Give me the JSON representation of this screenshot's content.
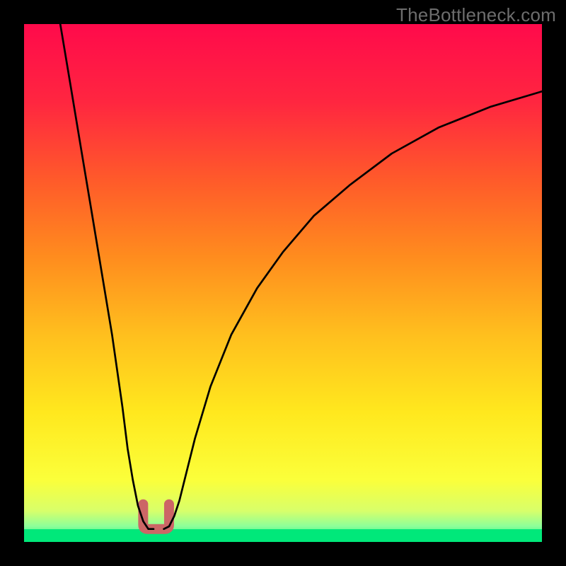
{
  "watermark": "TheBottleneck.com",
  "chart_data": {
    "type": "line",
    "title": "",
    "xlabel": "",
    "ylabel": "",
    "xlim": [
      0,
      100
    ],
    "ylim": [
      0,
      100
    ],
    "series": [
      {
        "name": "curve-left",
        "x": [
          7,
          9,
          11,
          13,
          15,
          17,
          19,
          20,
          21,
          22,
          23,
          24,
          25
        ],
        "y": [
          100,
          88,
          76,
          64,
          52,
          40,
          26,
          18,
          12,
          7,
          4,
          2.5,
          2.5
        ]
      },
      {
        "name": "curve-right",
        "x": [
          27,
          28,
          29,
          30,
          31,
          33,
          36,
          40,
          45,
          50,
          56,
          63,
          71,
          80,
          90,
          100
        ],
        "y": [
          2.5,
          3,
          5,
          8,
          12,
          20,
          30,
          40,
          49,
          56,
          63,
          69,
          75,
          80,
          84,
          87
        ]
      }
    ],
    "green_band_y": [
      0,
      2.5
    ],
    "annotations": [
      {
        "name": "valley-marker",
        "x_range": [
          23,
          28
        ],
        "y": 2.5,
        "color": "#cc6666"
      }
    ],
    "gradient_stops": [
      {
        "y": 100,
        "color": "#ff0a4b"
      },
      {
        "y": 85,
        "color": "#ff2640"
      },
      {
        "y": 70,
        "color": "#ff5a2a"
      },
      {
        "y": 55,
        "color": "#ff8c1e"
      },
      {
        "y": 40,
        "color": "#ffbf1e"
      },
      {
        "y": 25,
        "color": "#ffe81e"
      },
      {
        "y": 12,
        "color": "#fbff3a"
      },
      {
        "y": 6,
        "color": "#d8ff6a"
      },
      {
        "y": 3,
        "color": "#8cff9a"
      },
      {
        "y": 0,
        "color": "#00e87a"
      }
    ]
  }
}
